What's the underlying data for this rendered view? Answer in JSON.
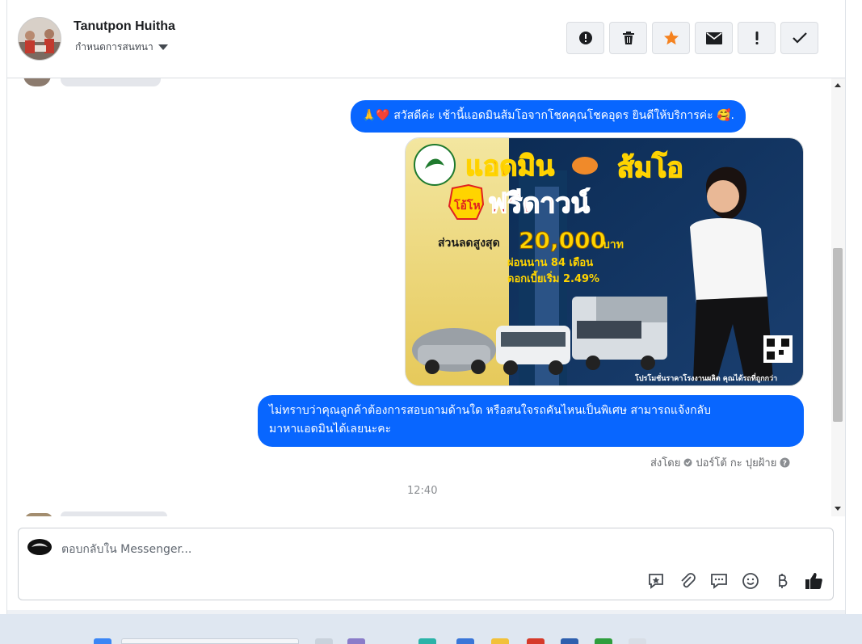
{
  "header": {
    "contact_name": "Tanutpon Huitha",
    "assign_label": "กำหนดการสนทนา",
    "actions": [
      {
        "name": "report-button",
        "icon": "alert-circle-icon",
        "glyph": "!"
      },
      {
        "name": "delete-button",
        "icon": "trash-icon",
        "glyph": ""
      },
      {
        "name": "star-button",
        "icon": "star-icon",
        "glyph": "★"
      },
      {
        "name": "mark-unread-button",
        "icon": "envelope-icon",
        "glyph": "✉"
      },
      {
        "name": "follow-up-button",
        "icon": "exclamation-icon",
        "glyph": "!"
      },
      {
        "name": "mark-done-button",
        "icon": "check-icon",
        "glyph": "✓"
      }
    ]
  },
  "messages": {
    "greeting": "🙏❤️ สวัสดีค่ะ เช้านี้แอดมินส้มโอจากโชคคุณโชคอุดร ยินดีให้บริการค่ะ 🥰.",
    "question_line1": "ไม่ทราบว่าคุณลูกค้าต้องการสอบถามด้านใด หรือสนใจรถคันไหนเป็นพิเศษ สามารถแจ้งกลับ",
    "question_line2": "มาหาแอดมินได้เลยนะคะ",
    "sent_by_prefix": "ส่งโดย",
    "sent_by_name": "ปอร์โต้ กะ ปุยฝ้าย",
    "timestamp": "12:40"
  },
  "promo": {
    "title": "แอดมิน",
    "title2": "ส้มโอ",
    "badge": "โอ้โห",
    "headline": "ฟรีดาวน์",
    "discount_label": "ส่วนลดสูงสุด",
    "discount_value": "20,000",
    "discount_unit": "บาท",
    "installment": "ผ่อนนาน 84 เดือน",
    "interest": "ดอกเบี้ยเริ่ม 2.49%",
    "footer": "โปรโมชั่นราคาโรงงานผลิต คุณได้รถที่ถูกกว่า"
  },
  "composer": {
    "placeholder": "ตอบกลับใน Messenger...",
    "tools": [
      "saved-replies-icon",
      "attachment-icon",
      "chat-bubble-icon",
      "emoji-icon",
      "baht-icon",
      "thumbs-up-icon"
    ]
  },
  "colors": {
    "outgoing_bubble": "#0866ff",
    "accent_star": "#f5821f"
  }
}
